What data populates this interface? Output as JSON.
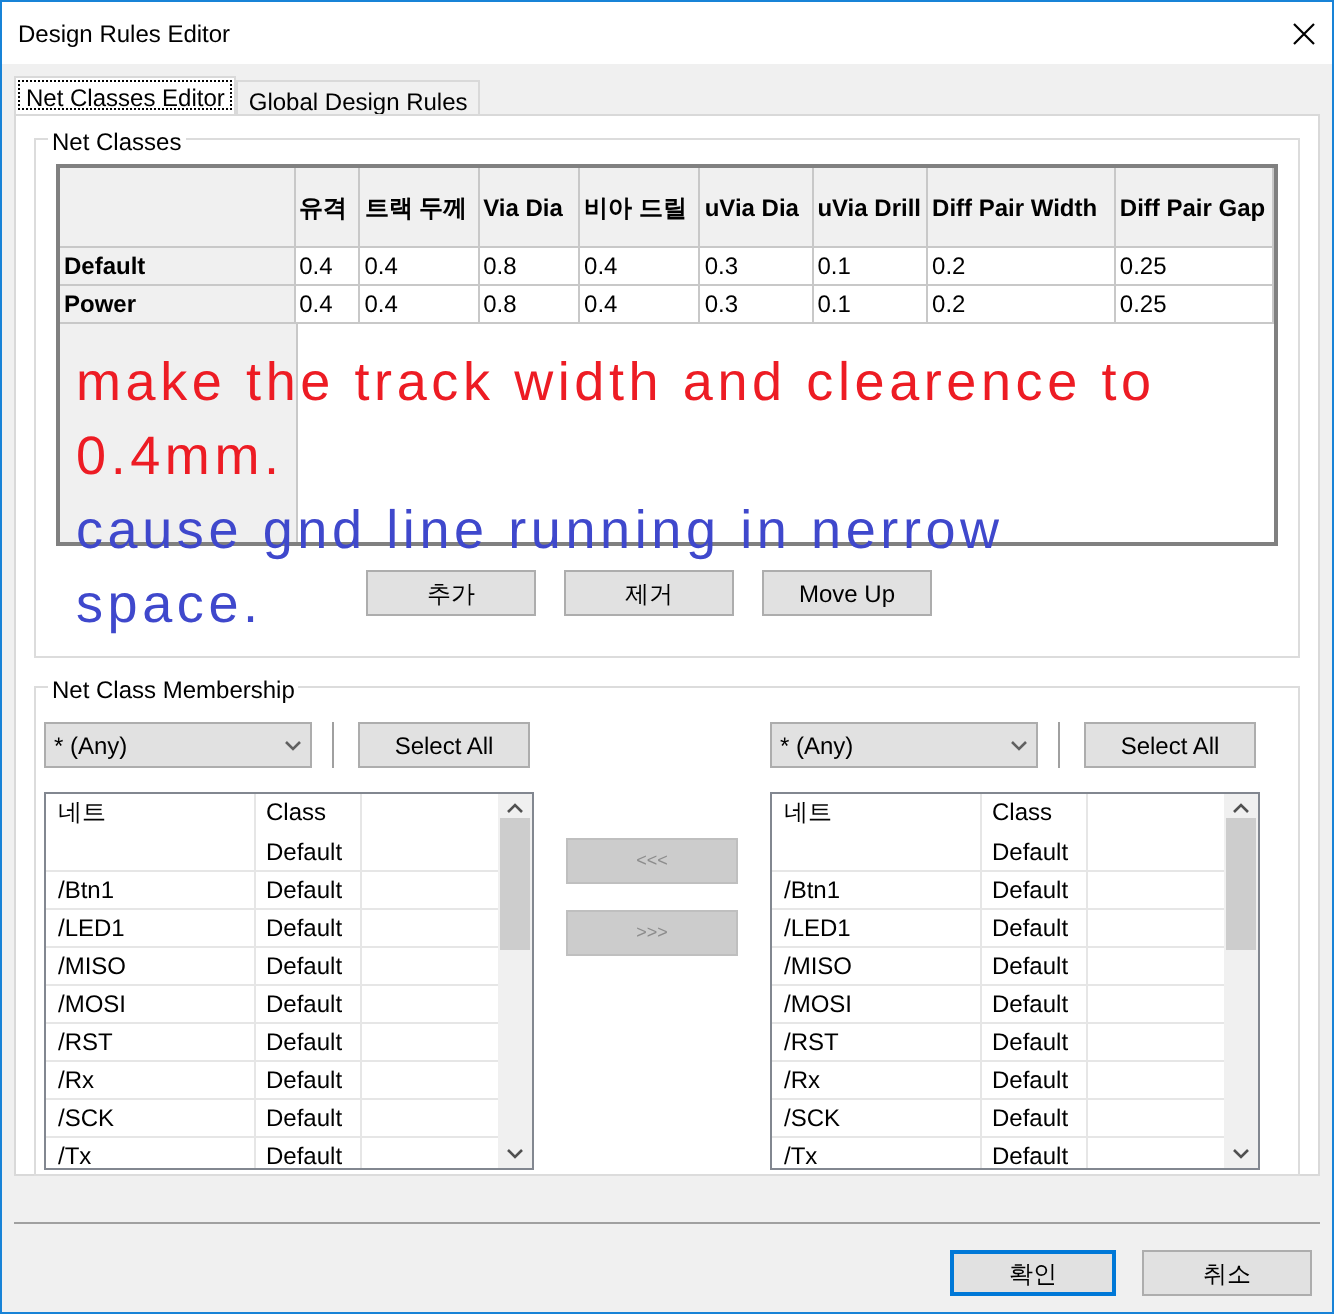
{
  "window": {
    "title": "Design Rules Editor"
  },
  "tabs": [
    {
      "label": "Net Classes Editor",
      "selected": true
    },
    {
      "label": "Global Design Rules",
      "selected": false
    }
  ],
  "net_classes": {
    "title": "Net Classes",
    "columns": [
      "유격",
      "트랙 두께",
      "Via Dia",
      "비아 드릴",
      "uVia Dia",
      "uVia Drill",
      "Diff Pair Width",
      "Diff Pair Gap"
    ],
    "rows": [
      {
        "name": "Default",
        "values": [
          "0.4",
          "0.4",
          "0.8",
          "0.4",
          "0.3",
          "0.1",
          "0.2",
          "0.25"
        ]
      },
      {
        "name": "Power",
        "values": [
          "0.4",
          "0.4",
          "0.8",
          "0.4",
          "0.3",
          "0.1",
          "0.2",
          "0.25"
        ]
      }
    ],
    "annotation": [
      {
        "text": "make the track width and clearence to",
        "color": "#ed1c24"
      },
      {
        "text": "0.4mm.",
        "color": "#ed1c24"
      },
      {
        "text": "cause gnd line running in nerrow",
        "color": "#3f48cc"
      },
      {
        "text": "space.",
        "color": "#3f48cc"
      }
    ],
    "buttons": [
      "추가",
      "제거",
      "Move Up"
    ]
  },
  "membership": {
    "title": "Net Class Membership",
    "panes": [
      {
        "filter": "* (Any)",
        "select_all": "Select All",
        "columns": [
          "네트",
          "Class"
        ],
        "rows": [
          {
            "class": "Default"
          },
          {
            "net": "/Btn1",
            "class": "Default"
          },
          {
            "net": "/LED1",
            "class": "Default"
          },
          {
            "net": "/MISO",
            "class": "Default"
          },
          {
            "net": "/MOSI",
            "class": "Default"
          },
          {
            "net": "/RST",
            "class": "Default"
          },
          {
            "net": "/Rx",
            "class": "Default"
          },
          {
            "net": "/SCK",
            "class": "Default"
          },
          {
            "net": "/Tx",
            "class": "Default"
          }
        ]
      },
      {
        "filter": "* (Any)",
        "select_all": "Select All",
        "columns": [
          "네트",
          "Class"
        ],
        "rows": [
          {
            "class": "Default"
          },
          {
            "net": "/Btn1",
            "class": "Default"
          },
          {
            "net": "/LED1",
            "class": "Default"
          },
          {
            "net": "/MISO",
            "class": "Default"
          },
          {
            "net": "/MOSI",
            "class": "Default"
          },
          {
            "net": "/RST",
            "class": "Default"
          },
          {
            "net": "/Rx",
            "class": "Default"
          },
          {
            "net": "/SCK",
            "class": "Default"
          },
          {
            "net": "/Tx",
            "class": "Default"
          }
        ]
      }
    ],
    "move_buttons": [
      {
        "label": "<<<",
        "disabled": true
      },
      {
        "label": ">>>",
        "disabled": true
      }
    ]
  },
  "footer": [
    {
      "label": "확인",
      "default": true
    },
    {
      "label": "취소",
      "default": false
    }
  ]
}
